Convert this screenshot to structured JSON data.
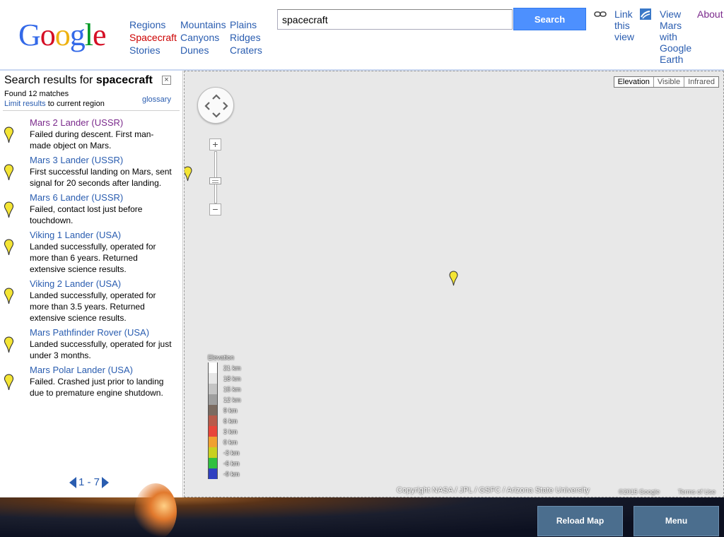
{
  "header": {
    "logo_letters": [
      {
        "ch": "G",
        "color": "#3369e8"
      },
      {
        "ch": "o",
        "color": "#d50f25"
      },
      {
        "ch": "o",
        "color": "#eeb211"
      },
      {
        "ch": "g",
        "color": "#3369e8"
      },
      {
        "ch": "l",
        "color": "#009925"
      },
      {
        "ch": "e",
        "color": "#d50f25"
      }
    ],
    "nav_col1": [
      "Regions",
      "Spacecraft",
      "Stories"
    ],
    "nav_col2": [
      "Mountains",
      "Canyons",
      "Dunes"
    ],
    "nav_col3": [
      "Plains",
      "Ridges",
      "Craters"
    ],
    "active_nav": "Spacecraft",
    "search_value": "spacecraft",
    "search_button": "Search",
    "link_view_line1": "Link",
    "link_view_line2": "this",
    "link_view_line3": "view",
    "earth_line1": "View",
    "earth_line2": "Mars",
    "earth_line3": "with",
    "earth_line4": "Google",
    "earth_line5": "Earth",
    "about": "About"
  },
  "sidebar": {
    "title_prefix": "Search results for ",
    "title_query": "spacecraft",
    "close_symbol": "×",
    "found": "Found 12 matches",
    "limit_link": "Limit results",
    "limit_rest": " to current region",
    "glossary": "glossary",
    "results": [
      {
        "title": "Mars 2 Lander (USSR)",
        "desc": "Failed during descent. First man-made object on Mars.",
        "visited": true
      },
      {
        "title": "Mars 3 Lander (USSR)",
        "desc": "First successful landing on Mars, sent signal for 20 seconds after landing.",
        "visited": false
      },
      {
        "title": "Mars 6 Lander (USSR)",
        "desc": "Failed, contact lost just before touchdown.",
        "visited": false
      },
      {
        "title": "Viking 1 Lander (USA)",
        "desc": "Landed successfully, operated for more than 6 years. Returned extensive science results.",
        "visited": false
      },
      {
        "title": "Viking 2 Lander (USA)",
        "desc": "Landed successfully, operated for more than 3.5 years. Returned extensive science results.",
        "visited": false
      },
      {
        "title": "Mars Pathfinder Rover (USA)",
        "desc": "Landed successfully, operated for just under 3 months.",
        "visited": false
      },
      {
        "title": "Mars Polar Lander (USA)",
        "desc": "Failed. Crashed just prior to landing due to premature engine shutdown.",
        "visited": false
      }
    ],
    "pager_text": "1 - 7"
  },
  "map": {
    "types": [
      "Elevation",
      "Visible",
      "Infrared"
    ],
    "active_type": "Elevation",
    "legend_title": "Elevation",
    "legend": [
      {
        "label": "21 km",
        "color": "#ffffff"
      },
      {
        "label": "18 km",
        "color": "#e6e6e6"
      },
      {
        "label": "15 km",
        "color": "#c4c4c4"
      },
      {
        "label": "12 km",
        "color": "#9e9e9e"
      },
      {
        "label": "9 km",
        "color": "#7a6a60"
      },
      {
        "label": "6 km",
        "color": "#b85a4a"
      },
      {
        "label": "3 km",
        "color": "#e8453a"
      },
      {
        "label": "0 km",
        "color": "#f0a030"
      },
      {
        "label": "-3 km",
        "color": "#c8d020"
      },
      {
        "label": "-6 km",
        "color": "#30c040"
      },
      {
        "label": "-9 km",
        "color": "#3040c0"
      }
    ],
    "copyright": "Copyright NASA / JPL / GSFC / Arizona State University",
    "map_year": "©2015 Google",
    "terms": "Terms of Use",
    "pin_color": "#f4e534"
  },
  "footer": {
    "reload": "Reload Map",
    "menu": "Menu"
  }
}
